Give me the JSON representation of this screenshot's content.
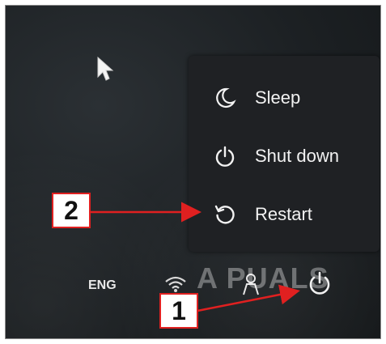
{
  "power_menu": {
    "items": [
      {
        "label": "Sleep",
        "icon": "moon-icon"
      },
      {
        "label": "Shut down",
        "icon": "power-icon"
      },
      {
        "label": "Restart",
        "icon": "restart-icon"
      }
    ]
  },
  "taskbar": {
    "language": "ENG",
    "icons": [
      "wifi-icon",
      "person-icon",
      "power-icon"
    ]
  },
  "watermark": "A  PUALS",
  "annotations": {
    "step1_label": "1",
    "step2_label": "2"
  },
  "colors": {
    "annotation_red": "#e02020",
    "menu_bg": "#1f2124",
    "menu_text": "#f2f2f2"
  }
}
